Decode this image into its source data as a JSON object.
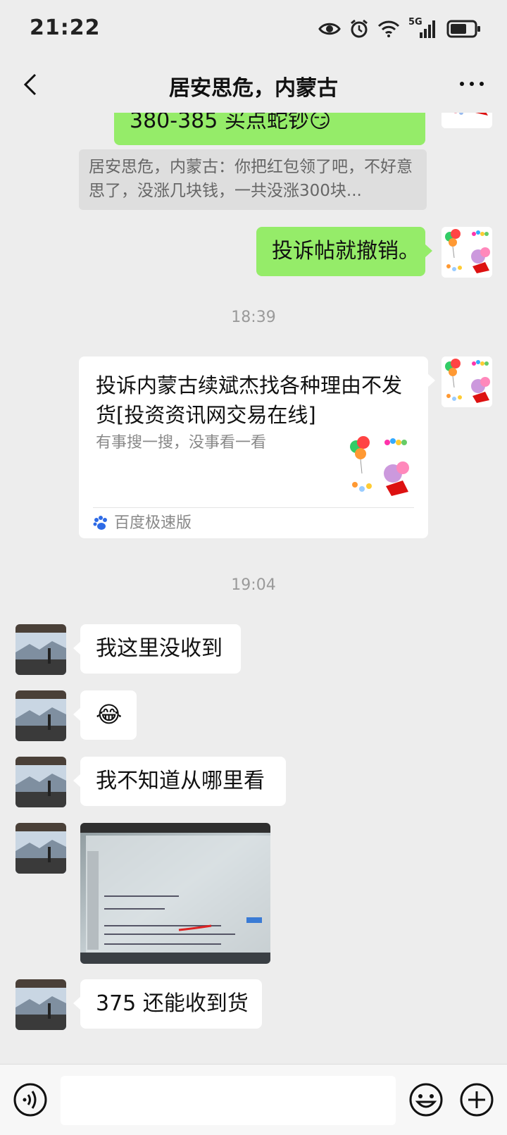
{
  "status": {
    "time": "21:22",
    "network": "5G",
    "icons": [
      "eye-icon",
      "alarm-icon",
      "wifi-icon",
      "signal-icon",
      "battery-icon"
    ]
  },
  "header": {
    "title": "居安思危，内蒙古",
    "back_icon": "chevron-left-icon",
    "more_icon": "more-dots-icon"
  },
  "messages": {
    "m1": {
      "text": "380-385 买点蛇钞😏"
    },
    "quote": {
      "text": "居安思危，内蒙古：你把红包领了吧，不好意思了，没涨几块钱，一共没涨300块..."
    },
    "m2": {
      "text": "投诉帖就撤销。"
    },
    "time1": "18:39",
    "card": {
      "title": "投诉内蒙古续斌杰找各种理由不发货[投资资讯网交易在线]",
      "desc": "有事搜一搜，没事看一看",
      "source": "百度极速版"
    },
    "time2": "19:04",
    "r1": {
      "text": "我这里没收到"
    },
    "r2": {
      "emoji": "😂"
    },
    "r3": {
      "text": "我不知道从哪里看"
    },
    "r5": {
      "text": "375 还能收到货"
    }
  },
  "input": {
    "voice_icon": "voice-icon",
    "emoji_icon": "emoji-icon",
    "plus_icon": "plus-icon",
    "value": ""
  },
  "colors": {
    "background": "#EDEDED",
    "outgoing_bubble": "#95EC69",
    "incoming_bubble": "#FFFFFF"
  }
}
